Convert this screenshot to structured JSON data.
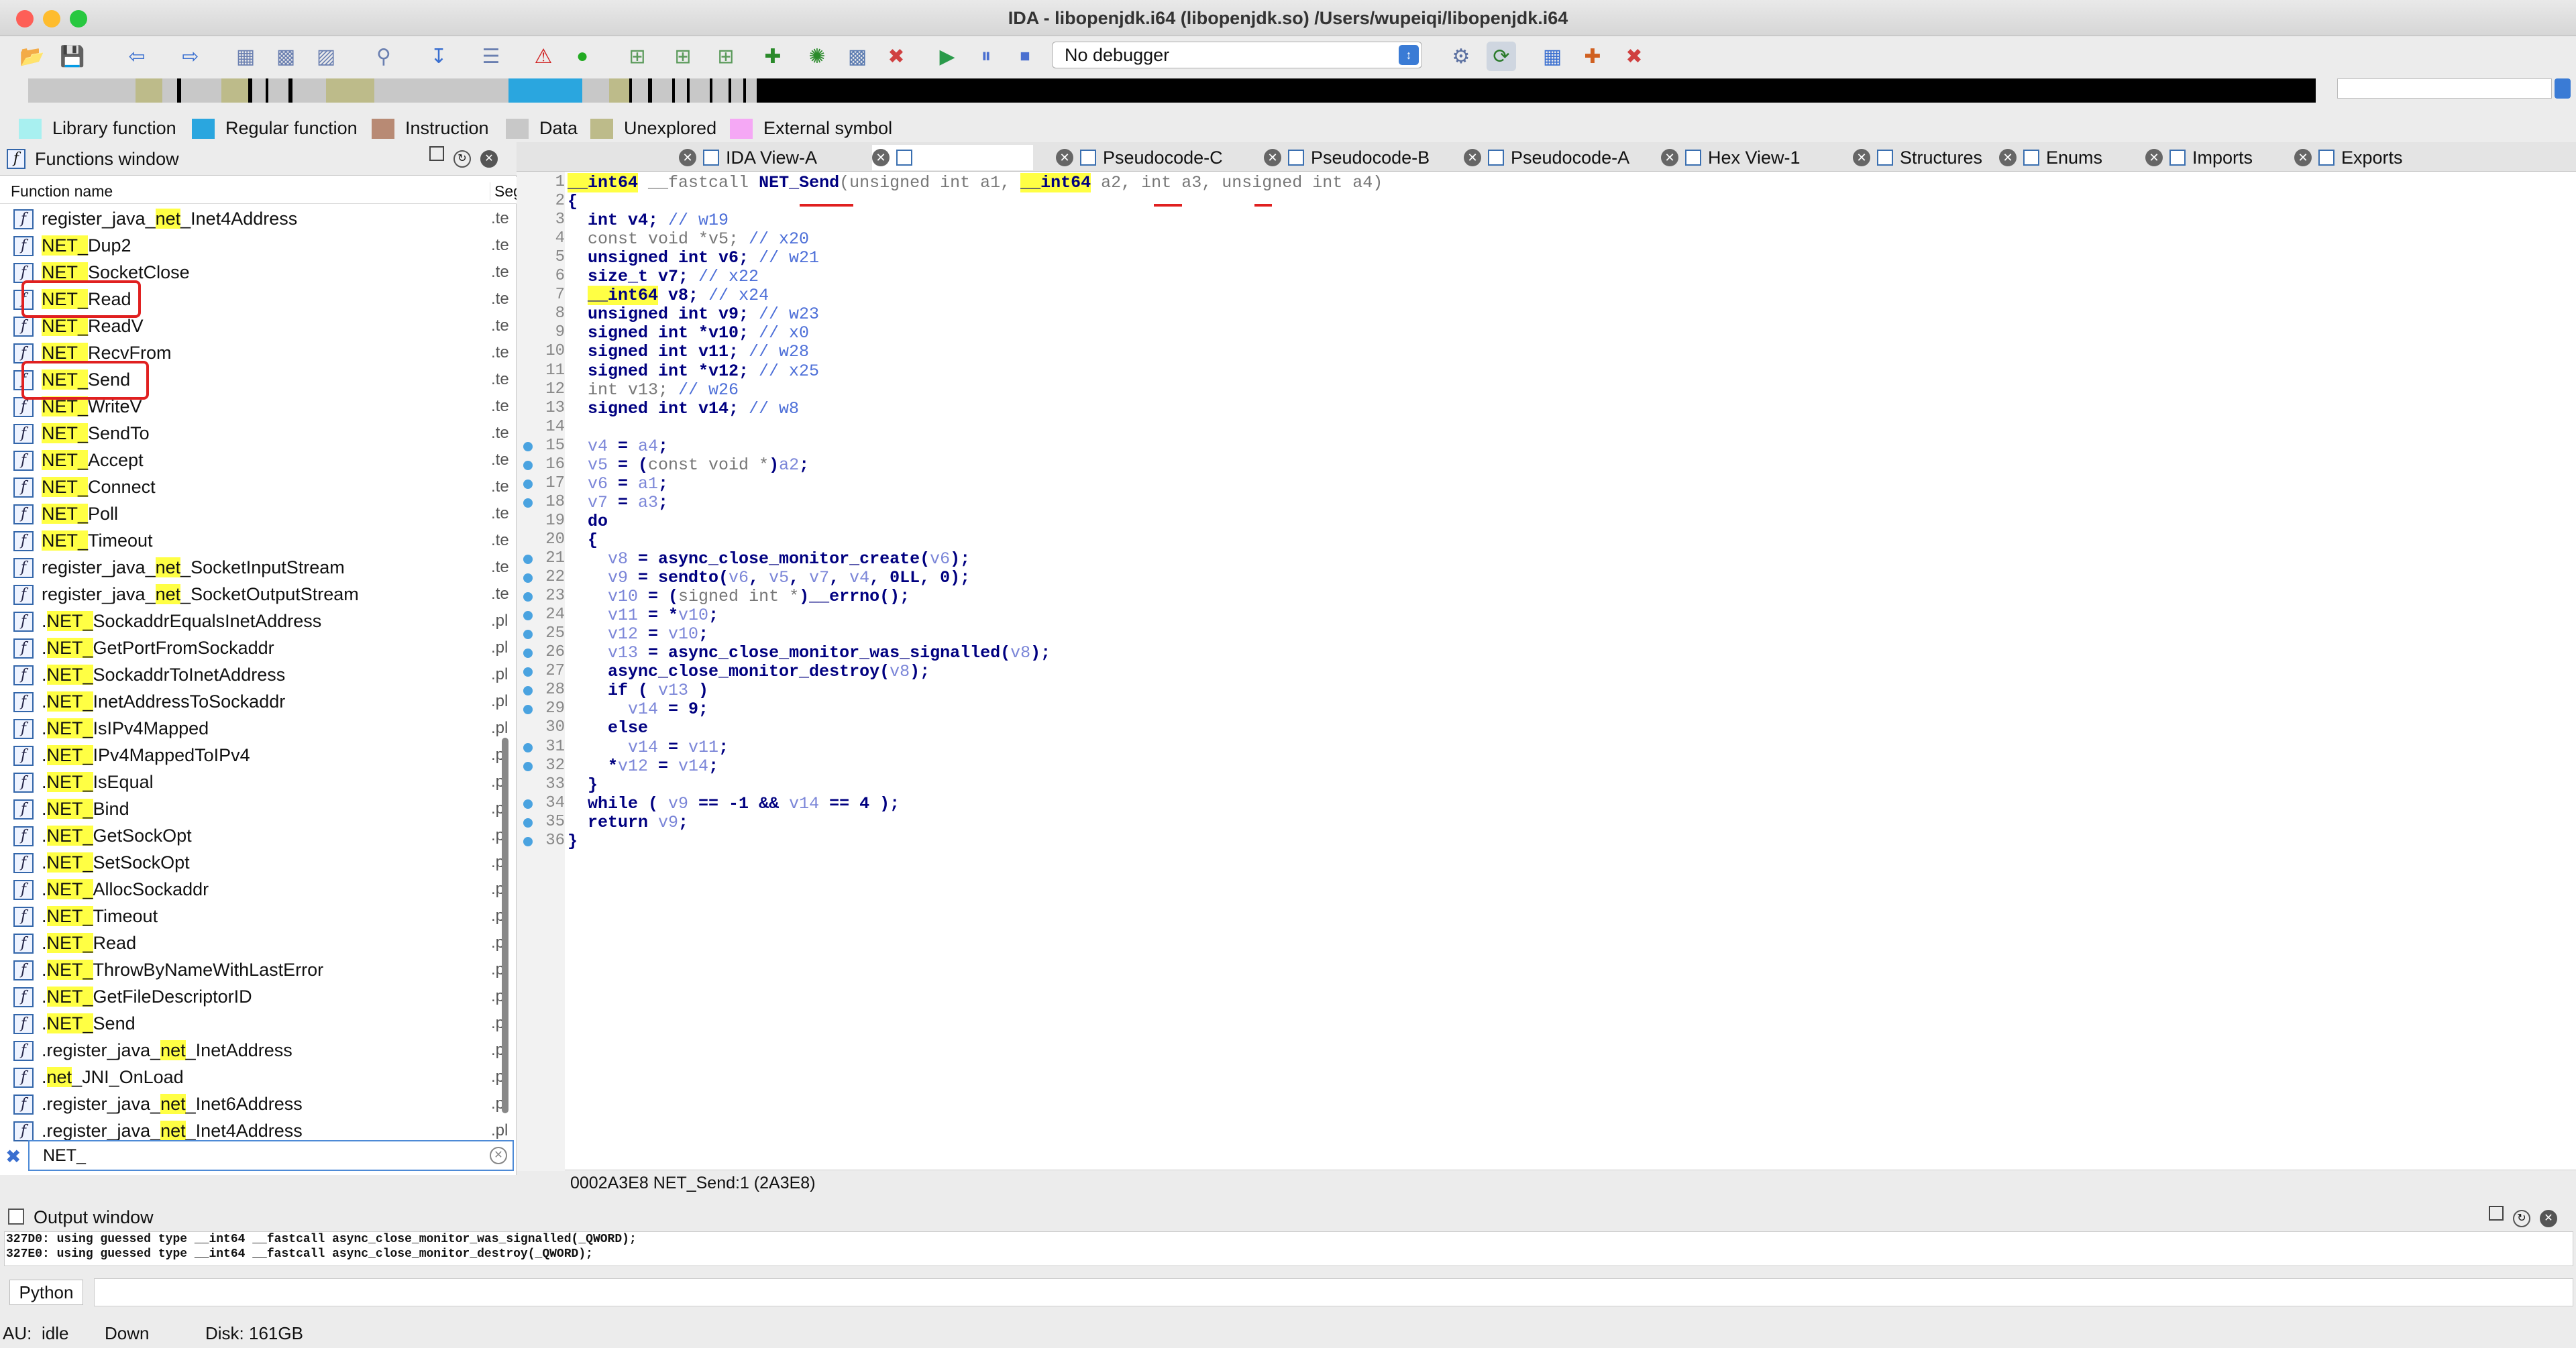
{
  "window": {
    "title": "IDA - libopenjdk.i64 (libopenjdk.so) /Users/wupeiqi/libopenjdk.i64"
  },
  "toolbar": {
    "debugger_label": "No debugger"
  },
  "legend": [
    {
      "label": "Library function",
      "color": "#a8f0f0"
    },
    {
      "label": "Regular function",
      "color": "#2aa6df"
    },
    {
      "label": "Instruction",
      "color": "#b88a74"
    },
    {
      "label": "Data",
      "color": "#c8c8c8"
    },
    {
      "label": "Unexplored",
      "color": "#bdbb8a"
    },
    {
      "label": "External symbol",
      "color": "#f5a8f5"
    }
  ],
  "functions_window": {
    "title": "Functions window",
    "col_name": "Function name",
    "col_segment": "Seg",
    "filter_value": "NET_",
    "rows": [
      {
        "pre": "register_java_",
        "hl": "net",
        "post": "_Inet4Address",
        "seg": ".te"
      },
      {
        "pre": "",
        "hl": "NET_",
        "post": "Dup2",
        "seg": ".te"
      },
      {
        "pre": "",
        "hl": "NET_",
        "post": "SocketClose",
        "seg": ".te"
      },
      {
        "pre": "",
        "hl": "NET_",
        "post": "Read",
        "seg": ".te"
      },
      {
        "pre": "",
        "hl": "NET_",
        "post": "ReadV",
        "seg": ".te"
      },
      {
        "pre": "",
        "hl": "NET_",
        "post": "RecvFrom",
        "seg": ".te"
      },
      {
        "pre": "",
        "hl": "NET_",
        "post": "Send",
        "seg": ".te"
      },
      {
        "pre": "",
        "hl": "NET_",
        "post": "WriteV",
        "seg": ".te"
      },
      {
        "pre": "",
        "hl": "NET_",
        "post": "SendTo",
        "seg": ".te"
      },
      {
        "pre": "",
        "hl": "NET_",
        "post": "Accept",
        "seg": ".te"
      },
      {
        "pre": "",
        "hl": "NET_",
        "post": "Connect",
        "seg": ".te"
      },
      {
        "pre": "",
        "hl": "NET_",
        "post": "Poll",
        "seg": ".te"
      },
      {
        "pre": "",
        "hl": "NET_",
        "post": "Timeout",
        "seg": ".te"
      },
      {
        "pre": "register_java_",
        "hl": "net",
        "post": "_SocketInputStream",
        "seg": ".te"
      },
      {
        "pre": "register_java_",
        "hl": "net",
        "post": "_SocketOutputStream",
        "seg": ".te"
      },
      {
        "pre": ".",
        "hl": "NET_",
        "post": "SockaddrEqualsInetAddress",
        "seg": ".pl"
      },
      {
        "pre": ".",
        "hl": "NET_",
        "post": "GetPortFromSockaddr",
        "seg": ".pl"
      },
      {
        "pre": ".",
        "hl": "NET_",
        "post": "SockaddrToInetAddress",
        "seg": ".pl"
      },
      {
        "pre": ".",
        "hl": "NET_",
        "post": "InetAddressToSockaddr",
        "seg": ".pl"
      },
      {
        "pre": ".",
        "hl": "NET_",
        "post": "IsIPv4Mapped",
        "seg": ".pl"
      },
      {
        "pre": ".",
        "hl": "NET_",
        "post": "IPv4MappedToIPv4",
        "seg": ".pl"
      },
      {
        "pre": ".",
        "hl": "NET_",
        "post": "IsEqual",
        "seg": ".pl"
      },
      {
        "pre": ".",
        "hl": "NET_",
        "post": "Bind",
        "seg": ".pl"
      },
      {
        "pre": ".",
        "hl": "NET_",
        "post": "GetSockOpt",
        "seg": ".pl"
      },
      {
        "pre": ".",
        "hl": "NET_",
        "post": "SetSockOpt",
        "seg": ".pl"
      },
      {
        "pre": ".",
        "hl": "NET_",
        "post": "AllocSockaddr",
        "seg": ".pl"
      },
      {
        "pre": ".",
        "hl": "NET_",
        "post": "Timeout",
        "seg": ".pl"
      },
      {
        "pre": ".",
        "hl": "NET_",
        "post": "Read",
        "seg": ".pl"
      },
      {
        "pre": ".",
        "hl": "NET_",
        "post": "ThrowByNameWithLastError",
        "seg": ".pl"
      },
      {
        "pre": ".",
        "hl": "NET_",
        "post": "GetFileDescriptorID",
        "seg": ".pl"
      },
      {
        "pre": ".",
        "hl": "NET_",
        "post": "Send",
        "seg": ".pl"
      },
      {
        "pre": ".register_java_",
        "hl": "net",
        "post": "_InetAddress",
        "seg": ".pl"
      },
      {
        "pre": ".",
        "hl": "net",
        "post": "_JNI_OnLoad",
        "seg": ".pl"
      },
      {
        "pre": ".register_java_",
        "hl": "net",
        "post": "_Inet6Address",
        "seg": ".pl"
      },
      {
        "pre": ".register_java_",
        "hl": "net",
        "post": "_Inet4Address",
        "seg": ".pl"
      }
    ]
  },
  "tabs": [
    {
      "label": "IDA View-A"
    },
    {
      "label": ""
    },
    {
      "label": "Pseudocode-C"
    },
    {
      "label": "Pseudocode-B"
    },
    {
      "label": "Pseudocode-A"
    },
    {
      "label": "Hex View-1"
    },
    {
      "label": "Structures"
    },
    {
      "label": "Enums"
    },
    {
      "label": "Imports"
    },
    {
      "label": "Exports"
    }
  ],
  "code_lines": [
    {
      "n": "1",
      "segs": [
        [
          "yl",
          "__int64"
        ],
        [
          "g",
          " __fastcall "
        ],
        [
          "k",
          "NET_Send"
        ],
        [
          "g",
          "(unsigned int a1, "
        ],
        [
          "yl",
          "__int64"
        ],
        [
          "g",
          " a2, int a3, unsigned int a4)"
        ]
      ]
    },
    {
      "n": "2",
      "segs": [
        [
          "k",
          "{"
        ]
      ]
    },
    {
      "n": "3",
      "segs": [
        [
          "k",
          "  int v4; "
        ],
        [
          "c",
          "// w19"
        ]
      ]
    },
    {
      "n": "4",
      "segs": [
        [
          "g",
          "  const void *v5; "
        ],
        [
          "c",
          "// x20"
        ]
      ]
    },
    {
      "n": "5",
      "segs": [
        [
          "k",
          "  unsigned int v6; "
        ],
        [
          "c",
          "// w21"
        ]
      ]
    },
    {
      "n": "6",
      "segs": [
        [
          "k",
          "  size_t v7; "
        ],
        [
          "c",
          "// x22"
        ]
      ]
    },
    {
      "n": "7",
      "segs": [
        [
          "k",
          "  "
        ],
        [
          "yl",
          "__int64"
        ],
        [
          "k",
          " v8; "
        ],
        [
          "c",
          "// x24"
        ]
      ]
    },
    {
      "n": "8",
      "segs": [
        [
          "k",
          "  unsigned int v9; "
        ],
        [
          "c",
          "// w23"
        ]
      ]
    },
    {
      "n": "9",
      "segs": [
        [
          "k",
          "  signed int *v10; "
        ],
        [
          "c",
          "// x0"
        ]
      ]
    },
    {
      "n": "10",
      "segs": [
        [
          "k",
          "  signed int v11; "
        ],
        [
          "c",
          "// w28"
        ]
      ]
    },
    {
      "n": "11",
      "segs": [
        [
          "k",
          "  signed int *v12; "
        ],
        [
          "c",
          "// x25"
        ]
      ]
    },
    {
      "n": "12",
      "segs": [
        [
          "g",
          "  int v13; "
        ],
        [
          "c",
          "// w26"
        ]
      ]
    },
    {
      "n": "13",
      "segs": [
        [
          "k",
          "  signed int v14; "
        ],
        [
          "c",
          "// w8"
        ]
      ]
    },
    {
      "n": "14",
      "segs": [
        [
          "k",
          ""
        ]
      ]
    },
    {
      "n": "15",
      "segs": [
        [
          "v",
          "  v4"
        ],
        [
          "k",
          " = "
        ],
        [
          "v",
          "a4"
        ],
        [
          "k",
          ";"
        ]
      ]
    },
    {
      "n": "16",
      "segs": [
        [
          "v",
          "  v5"
        ],
        [
          "k",
          " = ("
        ],
        [
          "g",
          "const void *"
        ],
        [
          "k",
          ")"
        ],
        [
          "v",
          "a2"
        ],
        [
          "k",
          ";"
        ]
      ]
    },
    {
      "n": "17",
      "segs": [
        [
          "v",
          "  v6"
        ],
        [
          "k",
          " = "
        ],
        [
          "v",
          "a1"
        ],
        [
          "k",
          ";"
        ]
      ]
    },
    {
      "n": "18",
      "segs": [
        [
          "v",
          "  v7"
        ],
        [
          "k",
          " = "
        ],
        [
          "v",
          "a3"
        ],
        [
          "k",
          ";"
        ]
      ]
    },
    {
      "n": "19",
      "segs": [
        [
          "k",
          "  do"
        ]
      ]
    },
    {
      "n": "20",
      "segs": [
        [
          "k",
          "  {"
        ]
      ]
    },
    {
      "n": "21",
      "segs": [
        [
          "v",
          "    v8"
        ],
        [
          "k",
          " = async_close_monitor_create("
        ],
        [
          "v",
          "v6"
        ],
        [
          "k",
          ");"
        ]
      ]
    },
    {
      "n": "22",
      "segs": [
        [
          "v",
          "    v9"
        ],
        [
          "k",
          " = sendto("
        ],
        [
          "v",
          "v6"
        ],
        [
          "k",
          ", "
        ],
        [
          "v",
          "v5"
        ],
        [
          "k",
          ", "
        ],
        [
          "v",
          "v7"
        ],
        [
          "k",
          ", "
        ],
        [
          "v",
          "v4"
        ],
        [
          "k",
          ", 0LL, 0);"
        ]
      ]
    },
    {
      "n": "23",
      "segs": [
        [
          "v",
          "    v10"
        ],
        [
          "k",
          " = ("
        ],
        [
          "g",
          "signed int *"
        ],
        [
          "k",
          ")__errno();"
        ]
      ]
    },
    {
      "n": "24",
      "segs": [
        [
          "v",
          "    v11"
        ],
        [
          "k",
          " = *"
        ],
        [
          "v",
          "v10"
        ],
        [
          "k",
          ";"
        ]
      ]
    },
    {
      "n": "25",
      "segs": [
        [
          "v",
          "    v12"
        ],
        [
          "k",
          " = "
        ],
        [
          "v",
          "v10"
        ],
        [
          "k",
          ";"
        ]
      ]
    },
    {
      "n": "26",
      "segs": [
        [
          "v",
          "    v13"
        ],
        [
          "k",
          " = async_close_monitor_was_signalled("
        ],
        [
          "v",
          "v8"
        ],
        [
          "k",
          ");"
        ]
      ]
    },
    {
      "n": "27",
      "segs": [
        [
          "k",
          "    async_close_monitor_destroy("
        ],
        [
          "v",
          "v8"
        ],
        [
          "k",
          ");"
        ]
      ]
    },
    {
      "n": "28",
      "segs": [
        [
          "k",
          "    if ( "
        ],
        [
          "v",
          "v13"
        ],
        [
          "k",
          " )"
        ]
      ]
    },
    {
      "n": "29",
      "segs": [
        [
          "v",
          "      v14"
        ],
        [
          "k",
          " = 9;"
        ]
      ]
    },
    {
      "n": "30",
      "segs": [
        [
          "k",
          "    else"
        ]
      ]
    },
    {
      "n": "31",
      "segs": [
        [
          "v",
          "      v14"
        ],
        [
          "k",
          " = "
        ],
        [
          "v",
          "v11"
        ],
        [
          "k",
          ";"
        ]
      ]
    },
    {
      "n": "32",
      "segs": [
        [
          "k",
          "    *"
        ],
        [
          "v",
          "v12"
        ],
        [
          "k",
          " = "
        ],
        [
          "v",
          "v14"
        ],
        [
          "k",
          ";"
        ]
      ]
    },
    {
      "n": "33",
      "segs": [
        [
          "k",
          "  }"
        ]
      ]
    },
    {
      "n": "34",
      "segs": [
        [
          "k",
          "  while ( "
        ],
        [
          "v",
          "v9"
        ],
        [
          "k",
          " == -1 && "
        ],
        [
          "v",
          "v14"
        ],
        [
          "k",
          " == 4 );"
        ]
      ]
    },
    {
      "n": "35",
      "segs": [
        [
          "k",
          "  return "
        ],
        [
          "v",
          "v9"
        ],
        [
          "k",
          ";"
        ]
      ]
    },
    {
      "n": "36",
      "segs": [
        [
          "k",
          "}"
        ]
      ]
    }
  ],
  "status_line": "0002A3E8  NET_Send:1 (2A3E8)",
  "output_window": {
    "title": "Output window",
    "lines": [
      "327D0: using guessed type __int64 __fastcall async_close_monitor_was_signalled(_QWORD);",
      "327E0: using guessed type __int64 __fastcall async_close_monitor_destroy(_QWORD);"
    ],
    "python_label": "Python"
  },
  "status_bar": {
    "au": "AU:",
    "state": "idle",
    "direction": "Down",
    "disk": "Disk: 161GB"
  }
}
